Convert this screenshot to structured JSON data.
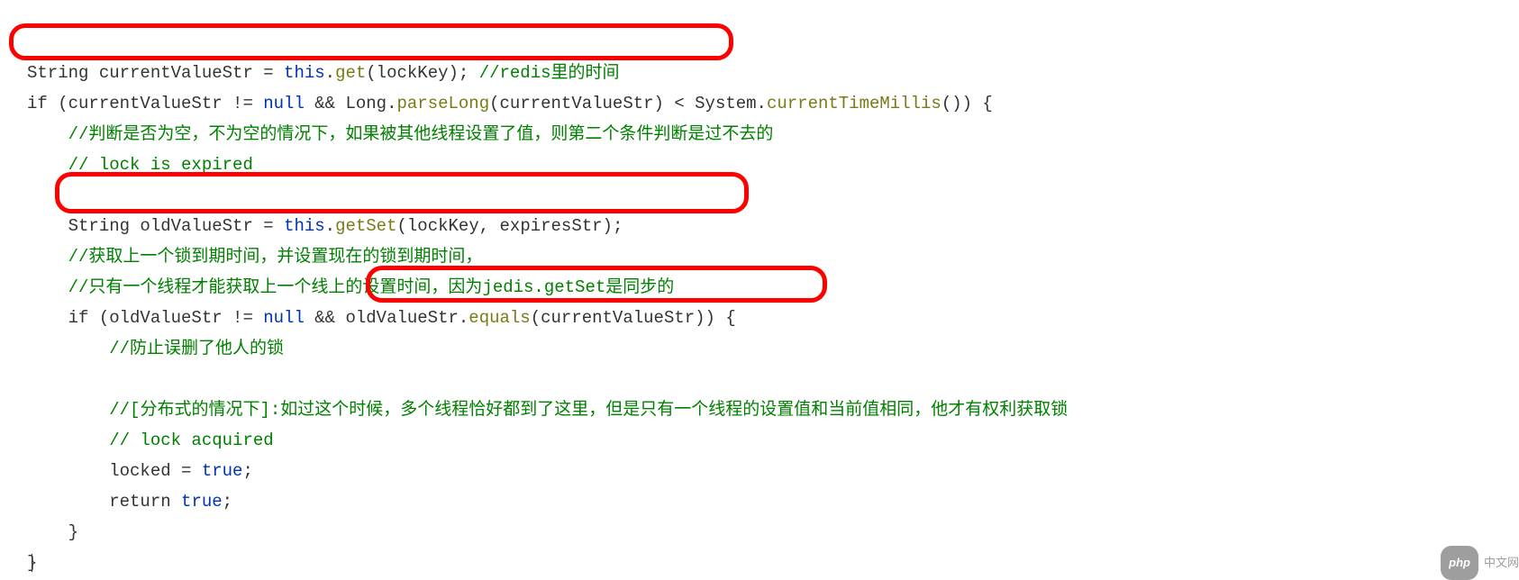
{
  "code": {
    "line1_pre": "String currentValueStr = ",
    "line1_this": "this",
    "line1_dot": ".",
    "line1_get": "get",
    "line1_post": "(lockKey); ",
    "line1_comment": "//redis里的时间",
    "line2_pre": "if (currentValueStr != ",
    "line2_null": "null",
    "line2_mid": " && Long.",
    "line2_parseLong": "parseLong",
    "line2_mid2": "(currentValueStr) < System.",
    "line2_ctm": "currentTimeMillis",
    "line2_post": "()) {",
    "line3_comment": "//判断是否为空，不为空的情况下，如果被其他线程设置了值，则第二个条件判断是过不去的",
    "line4_comment": "// lock is expired",
    "line5": "",
    "line6_pre": "String oldValueStr = ",
    "line6_this": "this",
    "line6_dot": ".",
    "line6_getSet": "getSet",
    "line6_post": "(lockKey, expiresStr);",
    "line7_comment": "//获取上一个锁到期时间，并设置现在的锁到期时间，",
    "line8_comment_pre": "//只有一个线程才能获取上一个线上的设置时间，因为",
    "line8_jedis": "jedis.getSet",
    "line8_comment_post": "是同步的",
    "line9_pre": "if (oldValueStr != ",
    "line9_null": "null",
    "line9_mid": " && oldValueStr.",
    "line9_equals": "equals",
    "line9_post": "(currentValueStr)) {",
    "line10_comment": "//防止误删了他人的锁",
    "line11": "",
    "line12_comment_pre": "//[",
    "line12_dist": "分布式的情况下",
    "line12_comment_post": "]:如过这个时候，多个线程恰好都到了这里，但是只有一个线程的设置值和当前值相同，他才有权利获取锁",
    "line13_comment": "// lock acquired",
    "line14_pre": "locked = ",
    "line14_true": "true",
    "line14_post": ";",
    "line15_pre": "return ",
    "line15_true": "true",
    "line15_post": ";",
    "line16": "}",
    "line17": "}"
  },
  "watermark": {
    "badge": "php",
    "text": "中文网"
  }
}
